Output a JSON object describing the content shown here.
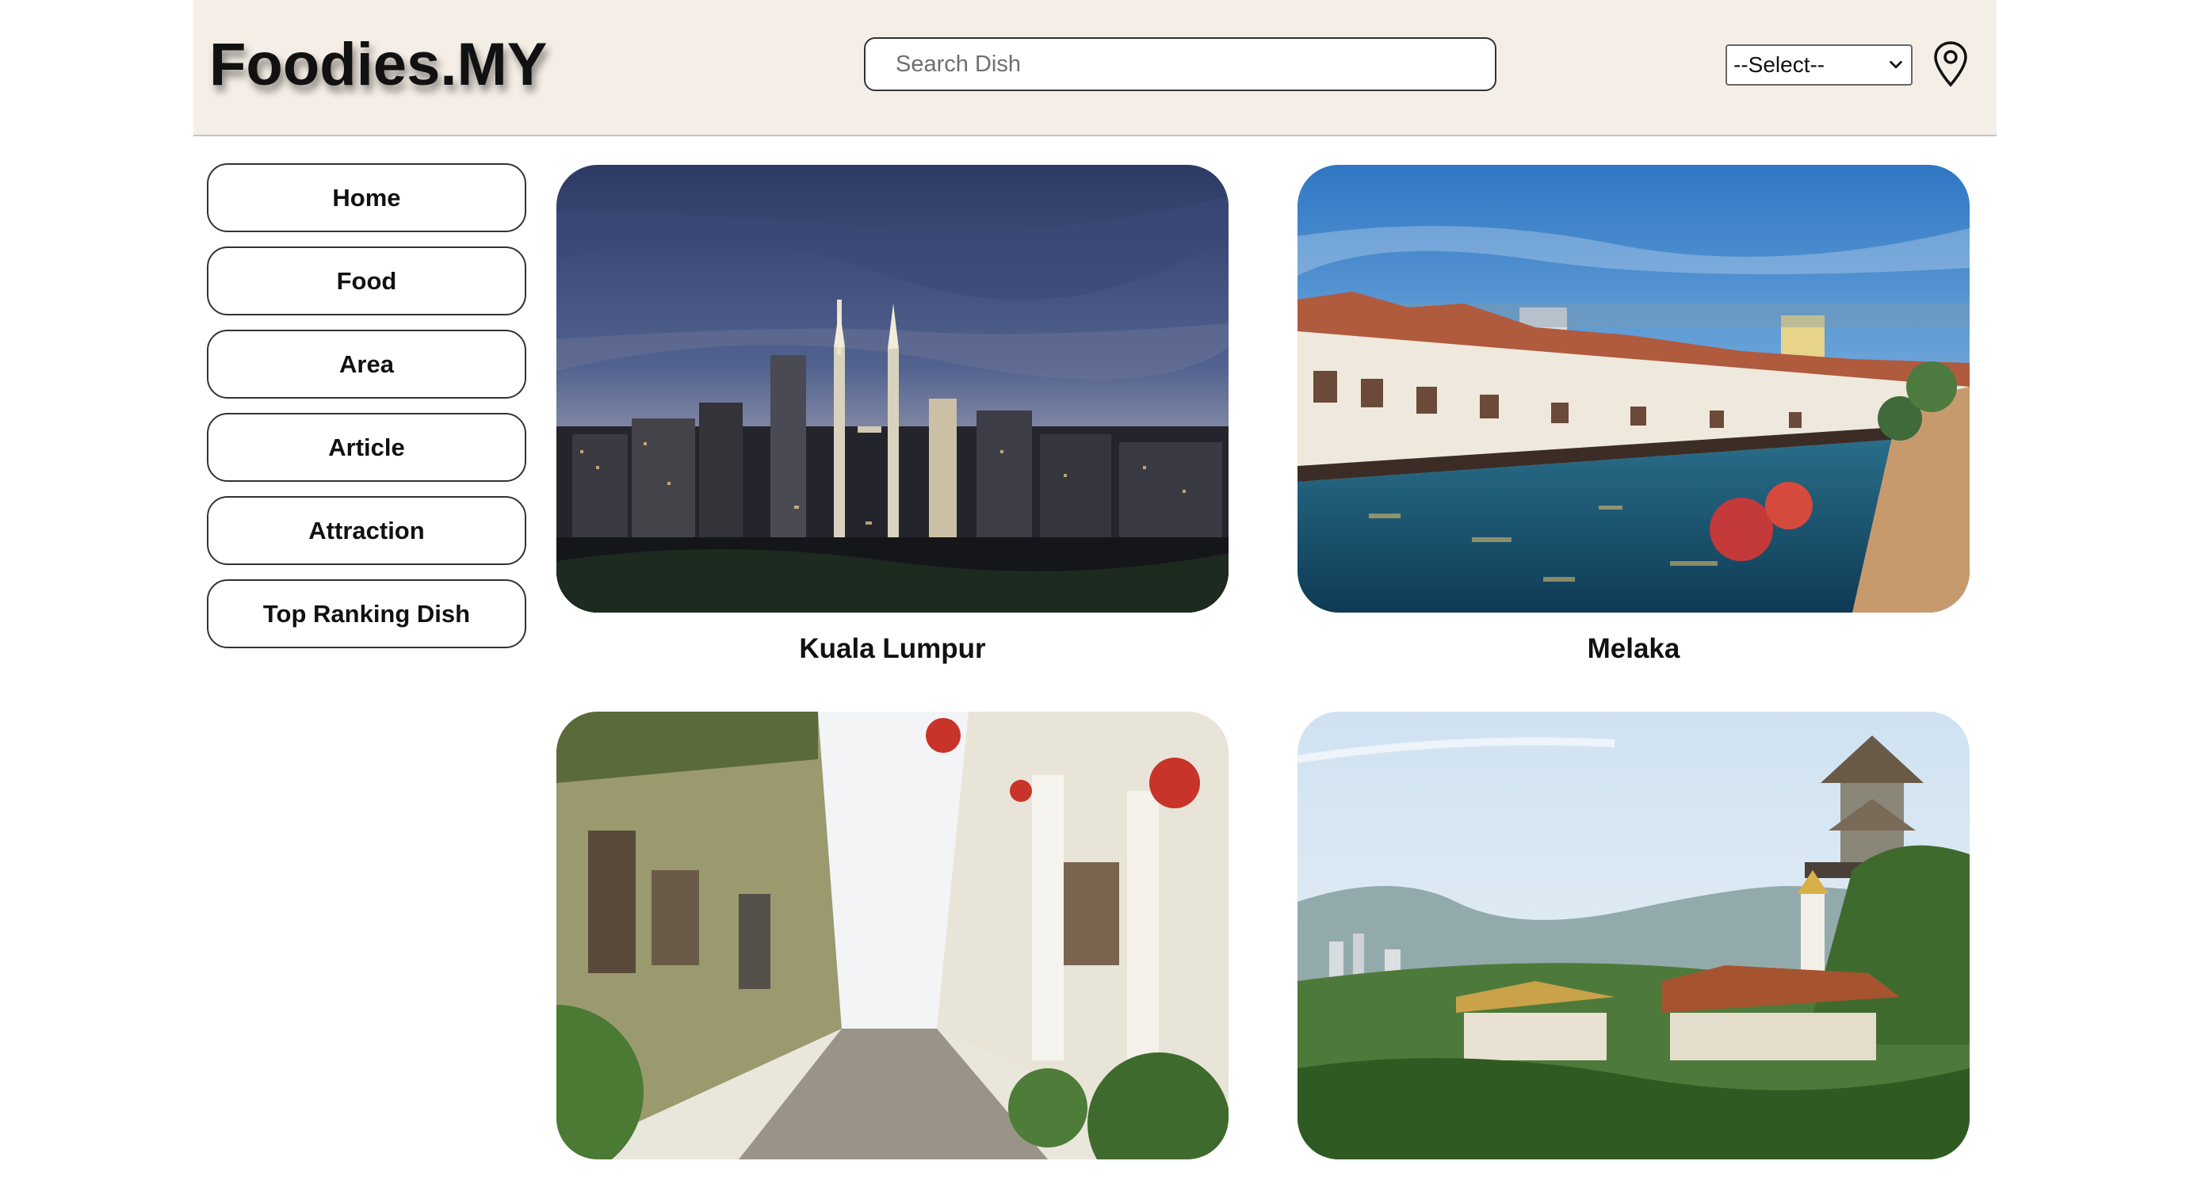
{
  "header": {
    "logo": "Foodies.MY",
    "search_placeholder": "Search Dish",
    "select_value": "--Select--"
  },
  "sidebar": {
    "items": [
      {
        "label": "Home"
      },
      {
        "label": "Food"
      },
      {
        "label": "Area"
      },
      {
        "label": "Article"
      },
      {
        "label": "Attraction"
      },
      {
        "label": "Top Ranking Dish"
      }
    ]
  },
  "areas": [
    {
      "name": "Kuala Lumpur"
    },
    {
      "name": "Melaka"
    },
    {
      "name": ""
    },
    {
      "name": ""
    }
  ]
}
